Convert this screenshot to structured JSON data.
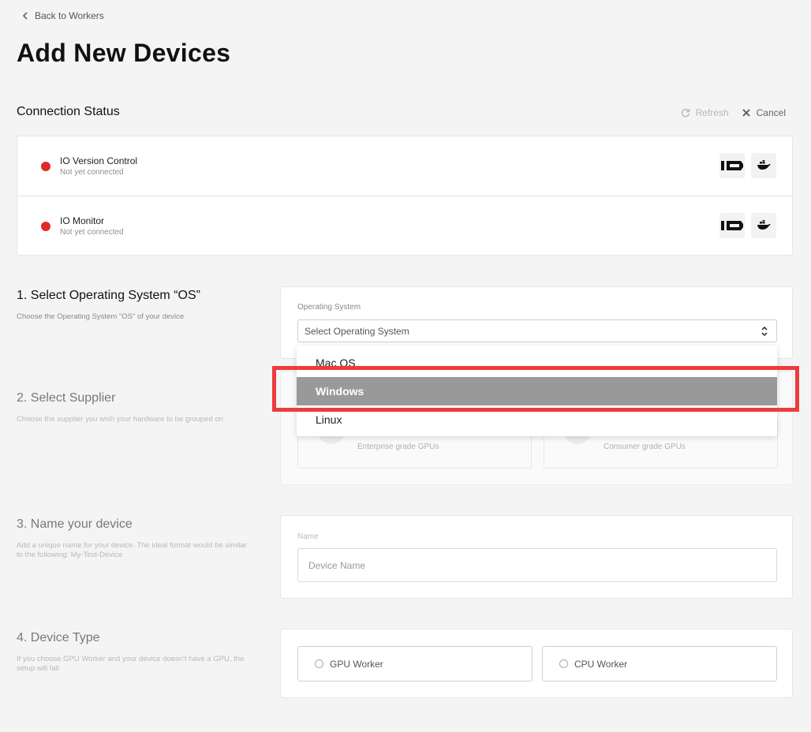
{
  "nav": {
    "back_label": "Back to Workers"
  },
  "page": {
    "title": "Add New Devices"
  },
  "connection": {
    "title": "Connection Status",
    "refresh_label": "Refresh",
    "cancel_label": "Cancel",
    "items": [
      {
        "name": "IO Version Control",
        "status": "Not yet connected",
        "status_color": "#e02a2a"
      },
      {
        "name": "IO Monitor",
        "status": "Not yet connected",
        "status_color": "#e02a2a"
      }
    ]
  },
  "os_section": {
    "title": "1. Select Operating System “OS”",
    "description": "Choose the Operating System \"OS\" of your device",
    "field_label": "Operating System",
    "select_value": "Select Operating System",
    "options": [
      "Mac OS",
      "Windows",
      "Linux"
    ],
    "highlighted_option": "Windows"
  },
  "supplier_section": {
    "title": "2. Select Supplier",
    "description": "Choose the supplier you wish your hardware to be grouped on",
    "cards": [
      {
        "subtitle": "Enterprise grade GPUs"
      },
      {
        "subtitle": "Consumer grade GPUs"
      }
    ]
  },
  "name_section": {
    "title": "3. Name your device",
    "description": "Add a unique name for your device. The ideal format would be similar to the following: My-Test-Device",
    "field_label": "Name",
    "placeholder": "Device Name"
  },
  "type_section": {
    "title": "4. Device Type",
    "description": "If you choose GPU Worker and your device doesn't have a GPU, the setup will fail",
    "options": [
      "GPU Worker",
      "CPU Worker"
    ]
  },
  "colors": {
    "accent_highlight": "#ec3c3f",
    "status_red": "#e02a2a",
    "selected_option_bg": "#999999"
  }
}
